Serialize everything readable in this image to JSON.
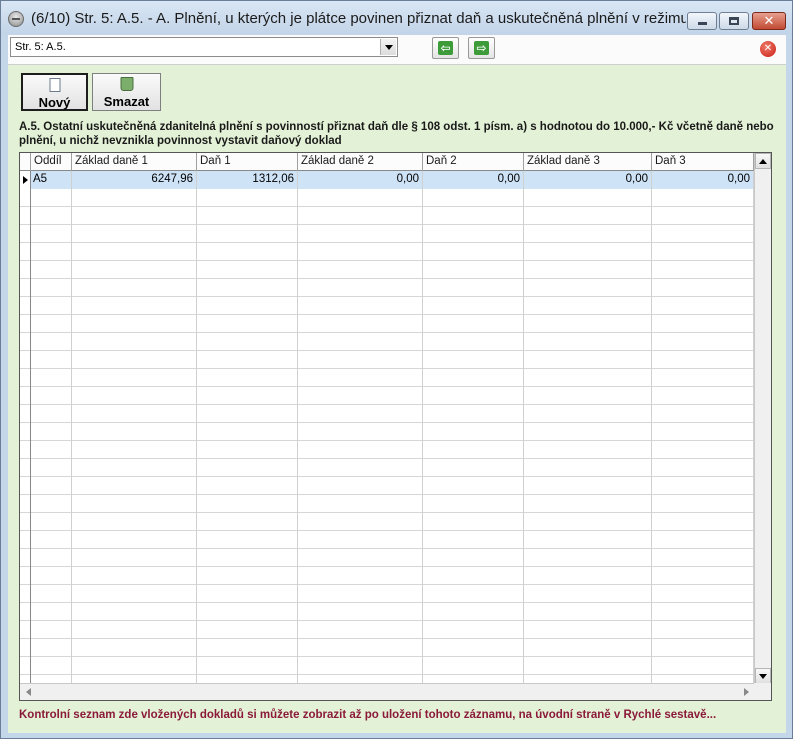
{
  "window": {
    "title": "(6/10) Str. 5: A.5. - A. Plnění, u kterých je plátce povinen přiznat daň a uskutečněná plnění v režimu..."
  },
  "toolbar": {
    "page_select_value": "Str. 5: A.5.",
    "nav_prev_icon": "arrow-left-icon",
    "nav_next_icon": "arrow-right-icon",
    "close_icon": "close-circle-icon",
    "new_label": "Nový",
    "delete_label": "Smazat"
  },
  "section": {
    "heading": "A.5. Ostatní uskutečněná zdanitelná plnění s povinností přiznat daň dle § 108 odst. 1 písm. a) s hodnotou do 10.000,- Kč včetně daně nebo plnění, u nichž nevznikla povinnost vystavit daňový doklad"
  },
  "grid": {
    "columns": [
      "Oddíl",
      "Základ daně 1",
      "Daň 1",
      "Základ daně 2",
      "Daň 2",
      "Základ daně 3",
      "Daň 3"
    ],
    "rows": [
      {
        "oddil": "A5",
        "zaklad1": "6247,96",
        "dan1": "1312,06",
        "zaklad2": "0,00",
        "dan2": "0,00",
        "zaklad3": "0,00",
        "dan3": "0,00"
      }
    ],
    "empty_rows": 28
  },
  "footer": {
    "note": "Kontrolní seznam zde vložených dokladů si můžete zobrazit až po uložení tohoto záznamu, na úvodní straně v Rychlé sestavě..."
  },
  "colors": {
    "client_bg": "#e3f1d6",
    "selected_row": "#cfe3f7",
    "footer_text": "#8b1a3a",
    "nav_green": "#3e9b3a"
  }
}
